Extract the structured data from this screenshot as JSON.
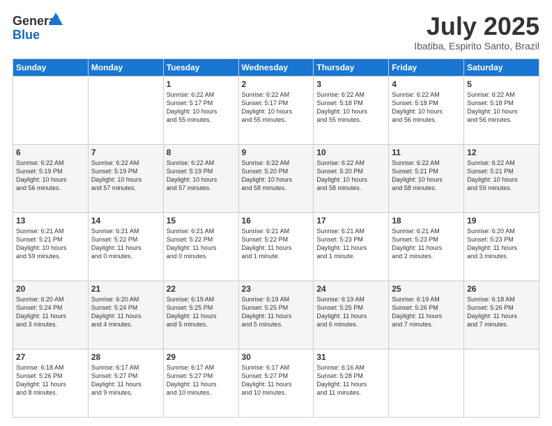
{
  "header": {
    "logo_line1": "General",
    "logo_line2": "Blue",
    "month_year": "July 2025",
    "location": "Ibatiba, Espirito Santo, Brazil"
  },
  "days_of_week": [
    "Sunday",
    "Monday",
    "Tuesday",
    "Wednesday",
    "Thursday",
    "Friday",
    "Saturday"
  ],
  "weeks": [
    [
      {
        "day": "",
        "info": ""
      },
      {
        "day": "",
        "info": ""
      },
      {
        "day": "1",
        "info": "Sunrise: 6:22 AM\nSunset: 5:17 PM\nDaylight: 10 hours\nand 55 minutes."
      },
      {
        "day": "2",
        "info": "Sunrise: 6:22 AM\nSunset: 5:17 PM\nDaylight: 10 hours\nand 55 minutes."
      },
      {
        "day": "3",
        "info": "Sunrise: 6:22 AM\nSunset: 5:18 PM\nDaylight: 10 hours\nand 55 minutes."
      },
      {
        "day": "4",
        "info": "Sunrise: 6:22 AM\nSunset: 5:18 PM\nDaylight: 10 hours\nand 56 minutes."
      },
      {
        "day": "5",
        "info": "Sunrise: 6:22 AM\nSunset: 5:18 PM\nDaylight: 10 hours\nand 56 minutes."
      }
    ],
    [
      {
        "day": "6",
        "info": "Sunrise: 6:22 AM\nSunset: 5:19 PM\nDaylight: 10 hours\nand 56 minutes."
      },
      {
        "day": "7",
        "info": "Sunrise: 6:22 AM\nSunset: 5:19 PM\nDaylight: 10 hours\nand 57 minutes."
      },
      {
        "day": "8",
        "info": "Sunrise: 6:22 AM\nSunset: 5:19 PM\nDaylight: 10 hours\nand 57 minutes."
      },
      {
        "day": "9",
        "info": "Sunrise: 6:22 AM\nSunset: 5:20 PM\nDaylight: 10 hours\nand 58 minutes."
      },
      {
        "day": "10",
        "info": "Sunrise: 6:22 AM\nSunset: 5:20 PM\nDaylight: 10 hours\nand 58 minutes."
      },
      {
        "day": "11",
        "info": "Sunrise: 6:22 AM\nSunset: 5:21 PM\nDaylight: 10 hours\nand 58 minutes."
      },
      {
        "day": "12",
        "info": "Sunrise: 6:22 AM\nSunset: 5:21 PM\nDaylight: 10 hours\nand 59 minutes."
      }
    ],
    [
      {
        "day": "13",
        "info": "Sunrise: 6:21 AM\nSunset: 5:21 PM\nDaylight: 10 hours\nand 59 minutes."
      },
      {
        "day": "14",
        "info": "Sunrise: 6:21 AM\nSunset: 5:22 PM\nDaylight: 11 hours\nand 0 minutes."
      },
      {
        "day": "15",
        "info": "Sunrise: 6:21 AM\nSunset: 5:22 PM\nDaylight: 11 hours\nand 0 minutes."
      },
      {
        "day": "16",
        "info": "Sunrise: 6:21 AM\nSunset: 5:22 PM\nDaylight: 11 hours\nand 1 minute."
      },
      {
        "day": "17",
        "info": "Sunrise: 6:21 AM\nSunset: 5:23 PM\nDaylight: 11 hours\nand 1 minute."
      },
      {
        "day": "18",
        "info": "Sunrise: 6:21 AM\nSunset: 5:23 PM\nDaylight: 11 hours\nand 2 minutes."
      },
      {
        "day": "19",
        "info": "Sunrise: 6:20 AM\nSunset: 5:23 PM\nDaylight: 11 hours\nand 3 minutes."
      }
    ],
    [
      {
        "day": "20",
        "info": "Sunrise: 6:20 AM\nSunset: 5:24 PM\nDaylight: 11 hours\nand 3 minutes."
      },
      {
        "day": "21",
        "info": "Sunrise: 6:20 AM\nSunset: 5:24 PM\nDaylight: 11 hours\nand 4 minutes."
      },
      {
        "day": "22",
        "info": "Sunrise: 6:19 AM\nSunset: 5:25 PM\nDaylight: 11 hours\nand 5 minutes."
      },
      {
        "day": "23",
        "info": "Sunrise: 6:19 AM\nSunset: 5:25 PM\nDaylight: 11 hours\nand 5 minutes."
      },
      {
        "day": "24",
        "info": "Sunrise: 6:19 AM\nSunset: 5:25 PM\nDaylight: 11 hours\nand 6 minutes."
      },
      {
        "day": "25",
        "info": "Sunrise: 6:19 AM\nSunset: 5:26 PM\nDaylight: 11 hours\nand 7 minutes."
      },
      {
        "day": "26",
        "info": "Sunrise: 6:18 AM\nSunset: 5:26 PM\nDaylight: 11 hours\nand 7 minutes."
      }
    ],
    [
      {
        "day": "27",
        "info": "Sunrise: 6:18 AM\nSunset: 5:26 PM\nDaylight: 11 hours\nand 8 minutes."
      },
      {
        "day": "28",
        "info": "Sunrise: 6:17 AM\nSunset: 5:27 PM\nDaylight: 11 hours\nand 9 minutes."
      },
      {
        "day": "29",
        "info": "Sunrise: 6:17 AM\nSunset: 5:27 PM\nDaylight: 11 hours\nand 10 minutes."
      },
      {
        "day": "30",
        "info": "Sunrise: 6:17 AM\nSunset: 5:27 PM\nDaylight: 11 hours\nand 10 minutes."
      },
      {
        "day": "31",
        "info": "Sunrise: 6:16 AM\nSunset: 5:28 PM\nDaylight: 11 hours\nand 11 minutes."
      },
      {
        "day": "",
        "info": ""
      },
      {
        "day": "",
        "info": ""
      }
    ]
  ]
}
